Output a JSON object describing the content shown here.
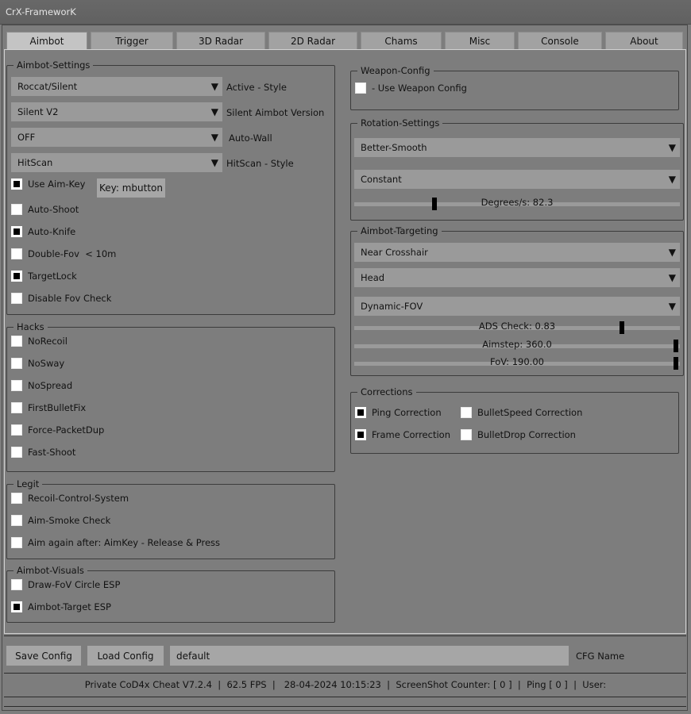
{
  "window": {
    "title": "CrX-FrameworK"
  },
  "tabs": [
    "Aimbot",
    "Trigger",
    "3D Radar",
    "2D Radar",
    "Chams",
    "Misc",
    "Console",
    "About"
  ],
  "aimbot_settings": {
    "title": "Aimbot-Settings",
    "style_value": "Roccat/Silent",
    "style_label": "Active - Style",
    "version_value": "Silent V2",
    "version_label": "Silent Aimbot Version",
    "autowall_value": "OFF",
    "autowall_label": "Auto-Wall",
    "hitscan_value": "HitScan",
    "hitscan_label": "HitScan - Style",
    "use_aim_key": "Use Aim-Key",
    "key_button": "Key: mbutton",
    "auto_shoot": "Auto-Shoot",
    "auto_knife": "Auto-Knife",
    "double_fov": "Double-Fov  < 10m",
    "target_lock": "TargetLock",
    "disable_fov_check": "Disable Fov Check"
  },
  "hacks": {
    "title": "Hacks",
    "no_recoil": "NoRecoil",
    "no_sway": "NoSway",
    "no_spread": "NoSpread",
    "first_bullet_fix": "FirstBulletFix",
    "force_packet_dup": "Force-PacketDup",
    "fast_shoot": "Fast-Shoot"
  },
  "legit": {
    "title": "Legit",
    "rcs": "Recoil-Control-System",
    "aim_smoke_check": "Aim-Smoke Check",
    "aim_again": "Aim again after: AimKey - Release & Press"
  },
  "aimbot_visuals": {
    "title": "Aimbot-Visuals",
    "draw_fov_circle": "Draw-FoV Circle ESP",
    "aimbot_target_esp": "Aimbot-Target ESP"
  },
  "weapon_config": {
    "title": "Weapon-Config",
    "use_weapon_config": "- Use Weapon Config"
  },
  "rotation_settings": {
    "title": "Rotation-Settings",
    "mode_value": "Better-Smooth",
    "speed_value": "Constant",
    "degrees_label": "Degrees/s: 82.3",
    "degrees_fraction": 0.24
  },
  "aimbot_targeting": {
    "title": "Aimbot-Targeting",
    "target_value": "Near Crosshair",
    "bone_value": "Head",
    "fov_mode_value": "Dynamic-FOV",
    "ads_check_label": "ADS Check: 0.83",
    "ads_check_fraction": 0.83,
    "aimstep_label": "Aimstep: 360.0",
    "aimstep_fraction": 1.0,
    "fov_label": "FoV: 190.00",
    "fov_fraction": 1.0
  },
  "corrections": {
    "title": "Corrections",
    "ping_correction": "Ping Correction",
    "bullet_speed_correction": "BulletSpeed Correction",
    "frame_correction": "Frame Correction",
    "bullet_drop_correction": "BulletDrop Correction"
  },
  "config": {
    "save_button": "Save Config",
    "load_button": "Load Config",
    "name_value": "default",
    "name_label": "CFG Name"
  },
  "status_bar": {
    "text": "Private CoD4x Cheat V7.2.4  |  62.5 FPS  |   28-04-2024 10:15:23  |  ScreenShot Counter: [ 0 ]  |  Ping [ 0 ]  |  User:"
  },
  "icons": {
    "dropdown_arrow": "triangle-down-icon"
  },
  "colors": {
    "background": "#7d7d7d",
    "control": "#9a9a9a",
    "active_tab": "#c4c4c4",
    "checkbox_fill": "#000000"
  }
}
